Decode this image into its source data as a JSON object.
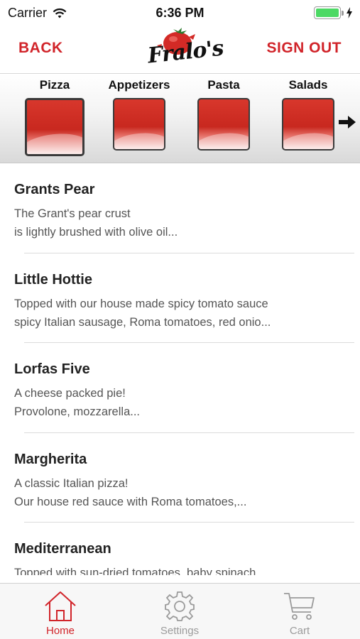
{
  "status_bar": {
    "carrier": "Carrier",
    "time": "6:36 PM"
  },
  "nav": {
    "back_label": "BACK",
    "logo_text": "Fralo's",
    "sign_out_label": "SIGN OUT"
  },
  "categories": [
    {
      "label": "Pizza",
      "selected": true
    },
    {
      "label": "Appetizers",
      "selected": false
    },
    {
      "label": "Pasta",
      "selected": false
    },
    {
      "label": "Salads",
      "selected": false
    }
  ],
  "menu_items": [
    {
      "title": "Grants Pear",
      "desc_line1": "The Grant's pear crust",
      "desc_line2": "is lightly brushed with olive oil..."
    },
    {
      "title": "Little Hottie",
      "desc_line1": "Topped with our house made spicy tomato sauce",
      "desc_line2": "spicy Italian sausage, Roma tomatoes, red onio..."
    },
    {
      "title": "Lorfas Five",
      "desc_line1": "A cheese packed pie!",
      "desc_line2": "Provolone, mozzarella..."
    },
    {
      "title": "Margherita",
      "desc_line1": "A classic Italian pizza!",
      "desc_line2": "Our house red sauce with Roma tomatoes,..."
    },
    {
      "title": "Mediterranean",
      "desc_line1": "Topped with sun-dried tomatoes, baby spinach",
      "desc_line2": ""
    }
  ],
  "tab_bar": {
    "tabs": [
      {
        "label": "Home",
        "icon": "home-icon",
        "active": true
      },
      {
        "label": "Settings",
        "icon": "gear-icon",
        "active": false
      },
      {
        "label": "Cart",
        "icon": "cart-icon",
        "active": false
      }
    ]
  },
  "colors": {
    "accent": "#d1242a",
    "tile_red": "#c8281f",
    "battery_green": "#4cd964",
    "inactive_tab": "#9b9b9b"
  }
}
